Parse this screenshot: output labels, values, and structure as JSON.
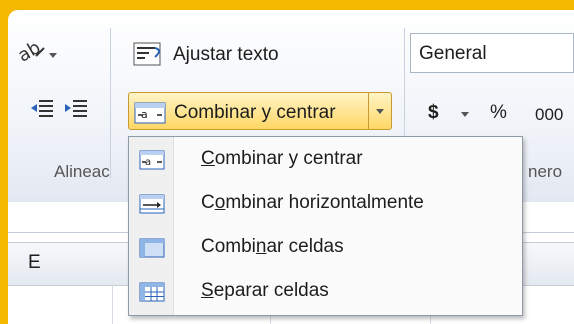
{
  "ribbon": {
    "wrap_text_label": "Ajustar texto",
    "merge_center_label": "Combinar y centrar",
    "number_format_value": "General",
    "currency_symbol": "$",
    "percent_symbol": "%",
    "thousands_label": "000",
    "alignment_group_label": "Alineac",
    "number_group_label": "nero"
  },
  "sheet": {
    "column_header": "E"
  },
  "menu": {
    "items": [
      {
        "pre": "",
        "u": "C",
        "post": "ombinar y centrar",
        "icon": "merge-center-icon"
      },
      {
        "pre": "C",
        "u": "o",
        "post": "mbinar horizontalmente",
        "icon": "merge-across-icon"
      },
      {
        "pre": "Combi",
        "u": "n",
        "post": "ar celdas",
        "icon": "merge-cells-icon"
      },
      {
        "pre": "",
        "u": "S",
        "post": "eparar celdas",
        "icon": "unmerge-cells-icon"
      }
    ]
  },
  "colors": {
    "frame": "#f5b800",
    "active_button": "#ffd765",
    "menu_bg": "#fbfbfb"
  }
}
